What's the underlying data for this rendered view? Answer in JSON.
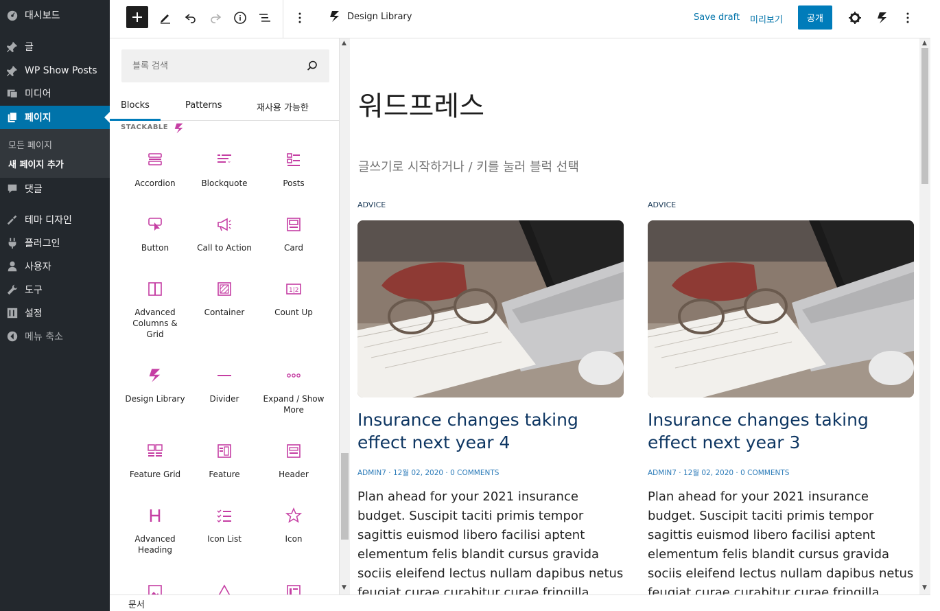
{
  "admin_menu": {
    "items": [
      {
        "label": "대시보드",
        "icon": "dashboard-icon"
      },
      {
        "label": "글",
        "icon": "pin-icon"
      },
      {
        "label": "WP Show Posts",
        "icon": "pin-icon"
      },
      {
        "label": "미디어",
        "icon": "media-icon"
      },
      {
        "label": "페이지",
        "icon": "pages-icon"
      },
      {
        "label": "댓글",
        "icon": "comments-icon"
      },
      {
        "label": "테마 디자인",
        "icon": "appearance-icon"
      },
      {
        "label": "플러그인",
        "icon": "plugins-icon"
      },
      {
        "label": "사용자",
        "icon": "users-icon"
      },
      {
        "label": "도구",
        "icon": "tools-icon"
      },
      {
        "label": "설정",
        "icon": "settings-icon"
      },
      {
        "label": "메뉴 축소",
        "icon": "collapse-icon"
      }
    ],
    "submenu": [
      "모든 페이지",
      "새 페이지 추가"
    ]
  },
  "toolbar": {
    "design_library": "Design Library",
    "save_draft": "Save draft",
    "preview": "미리보기",
    "publish": "공개"
  },
  "inserter": {
    "search_placeholder": "블록 검색",
    "tabs": [
      "Blocks",
      "Patterns",
      "재사용 가능한"
    ],
    "category": "STACKABLE",
    "blocks": [
      "Accordion",
      "Blockquote",
      "Posts",
      "Button",
      "Call to Action",
      "Card",
      "Advanced Columns & Grid",
      "Container",
      "Count Up",
      "Design Library",
      "Divider",
      "Expand / Show More",
      "Feature Grid",
      "Feature",
      "Header",
      "Advanced Heading",
      "Icon List",
      "Icon"
    ]
  },
  "canvas": {
    "title": "워드프레스",
    "placeholder": "글쓰기로 시작하거나 / 키를 눌러 블럭 선택",
    "posts": [
      {
        "category": "ADVICE",
        "title": "Insurance changes taking effect next year 4",
        "meta": "ADMIN7 · 12월 02, 2020 · 0 COMMENTS",
        "excerpt": "Plan ahead for your 2021 insurance budget. Suscipit taciti primis tempor sagittis euismod libero facilisi aptent elementum felis blandit cursus gravida sociis eleifend lectus nullam dapibus netus feugiat curae curabitur curae fringilla porttitor quam sollicitudin iaculis"
      },
      {
        "category": "ADVICE",
        "title": "Insurance changes taking effect next year 3",
        "meta": "ADMIN7 · 12월 02, 2020 · 0 COMMENTS",
        "excerpt": "Plan ahead for your 2021 insurance budget. Suscipit taciti primis tempor sagittis euismod libero facilisi aptent elementum felis blandit cursus gravida sociis eleifend lectus nullam dapibus netus feugiat curae curabitur curae fringilla porttitor quam sollicitudin iaculis"
      }
    ]
  },
  "footer": {
    "breadcrumb": "문서"
  },
  "colors": {
    "accent": "#007cba",
    "admin_bg": "#23282d",
    "stackable": "#c53ea3",
    "post_title": "#0e3662"
  }
}
